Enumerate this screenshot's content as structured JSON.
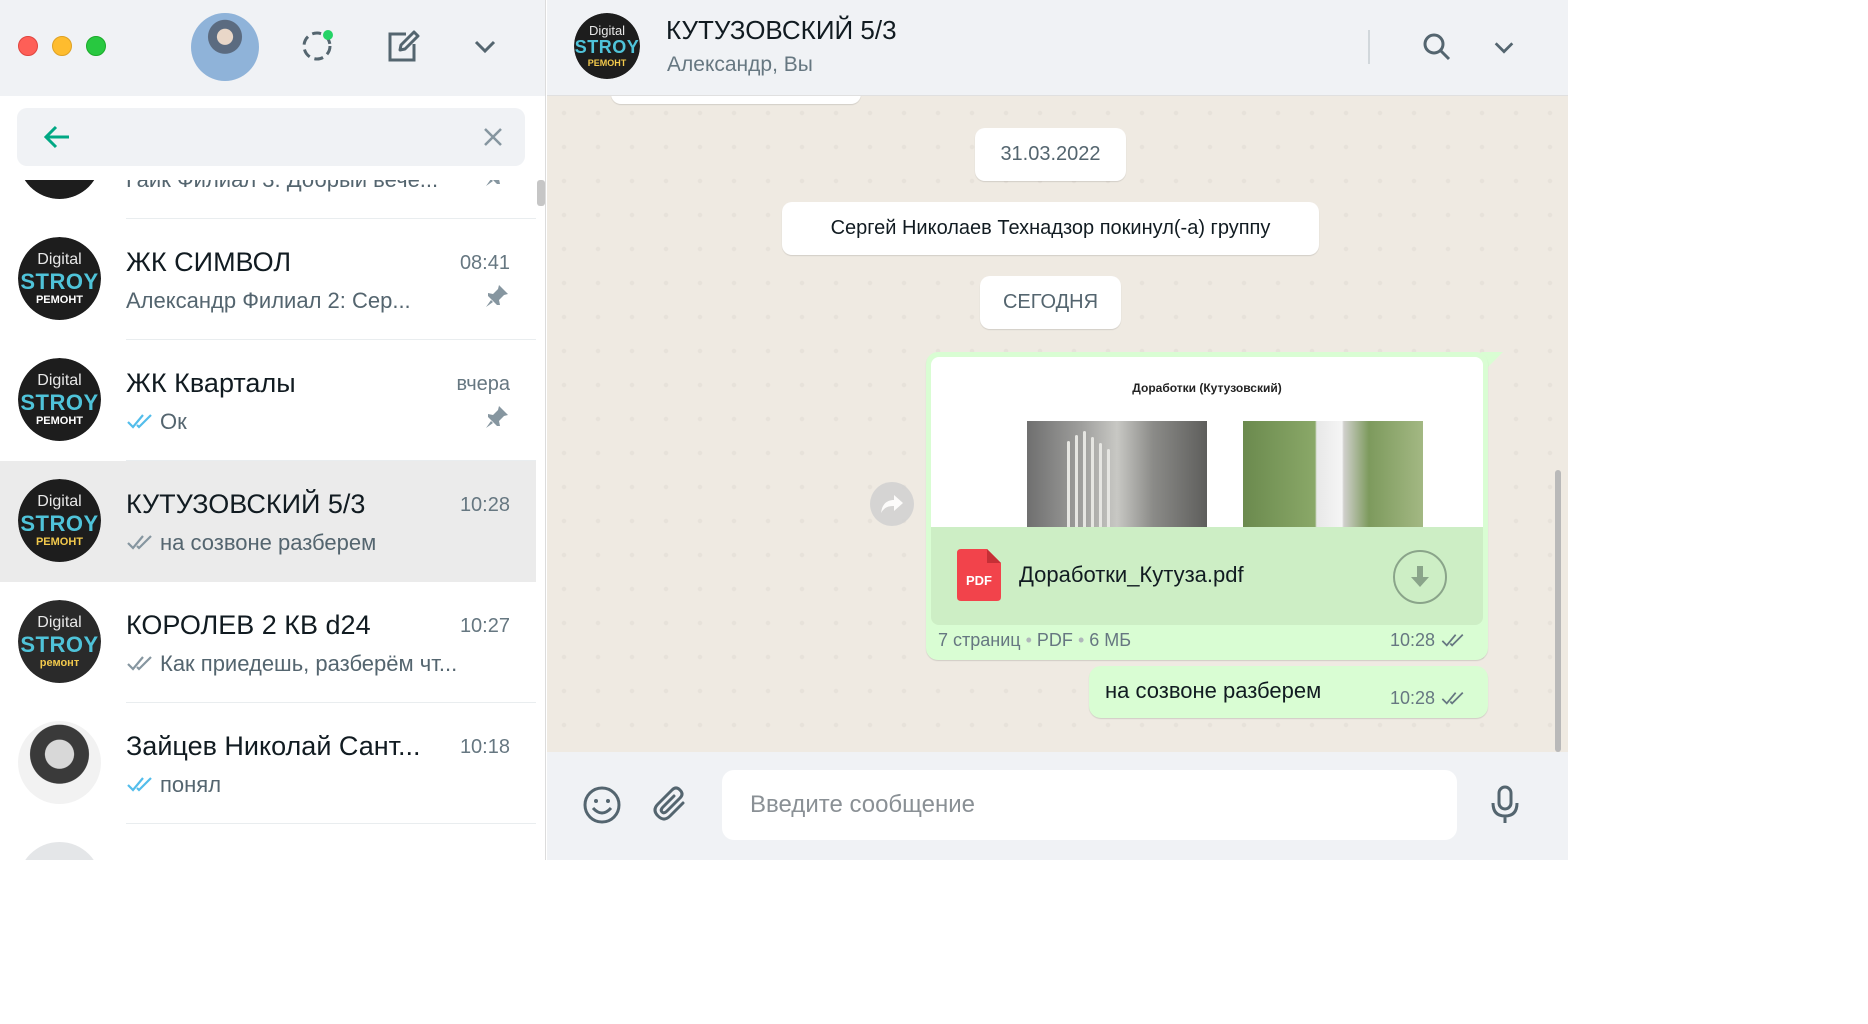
{
  "chat_list": [
    {
      "title": "",
      "time": "",
      "preview": "Гайк Филиал 3: Добрый вече...",
      "pinned": true,
      "avatar": "franchise-avatar"
    },
    {
      "title": "ЖК СИМВОЛ",
      "time": "08:41",
      "preview": "Александр Филиал 2: Сер...",
      "pinned": true,
      "avatar": "digital-stroy-logo",
      "logo": {
        "l1": "Digital",
        "l2": "STROY",
        "l3": "РЕМОНТ"
      }
    },
    {
      "title": "ЖК Кварталы",
      "time": "вчера",
      "preview": "Ок",
      "pinned": true,
      "avatar": "digital-stroy-logo",
      "logo": {
        "l1": "Digital",
        "l2": "STROY",
        "l3": "РЕМОНТ"
      }
    },
    {
      "title": "КУТУЗОВСКИЙ 5/3",
      "time": "10:28",
      "preview": "на созвоне разберем",
      "pinned": false,
      "active": true,
      "avatar": "digital-stroy-logo",
      "logo": {
        "l1": "Digital",
        "l2": "STROY",
        "l3": "РЕМОНТ"
      }
    },
    {
      "title": "КОРОЛЕВ 2 КВ d24",
      "time": "10:27",
      "preview": "Как приедешь, разберём чт...",
      "pinned": false,
      "avatar": "digital-stroy-logo",
      "logo": {
        "l1": "Digital",
        "l2": "STROY",
        "l3": "ремонт"
      }
    },
    {
      "title": "Зайцев Николай Сант...",
      "time": "10:18",
      "preview": "понял",
      "pinned": false,
      "avatar": "person-photo"
    }
  ],
  "chat_header": {
    "title": "КУТУЗОВСКИЙ 5/3",
    "subtitle": "Александр, Вы",
    "logo": {
      "l1": "Digital",
      "l2": "STROY",
      "l3": "РЕМОНТ"
    }
  },
  "messages": {
    "date_pill": "31.03.2022",
    "system_notice": "Сергей Николаев Технадзор покинул(-а) группу",
    "today_pill": "СЕГОДНЯ",
    "document": {
      "preview_heading": "Доработки (Кутузовский)",
      "pdf_badge": "PDF",
      "file_name": "Доработки_Кутуза.pdf",
      "pages": "7 страниц",
      "type": "PDF",
      "size": "6 МБ",
      "time": "10:28"
    },
    "text_message": {
      "text": "на созвоне разберем",
      "time": "10:28"
    }
  },
  "composer": {
    "placeholder": "Введите сообщение"
  },
  "colors": {
    "accent": "#00a884",
    "read_ticks": "#53bdeb",
    "outgoing_bubble": "#d9fdd3"
  }
}
